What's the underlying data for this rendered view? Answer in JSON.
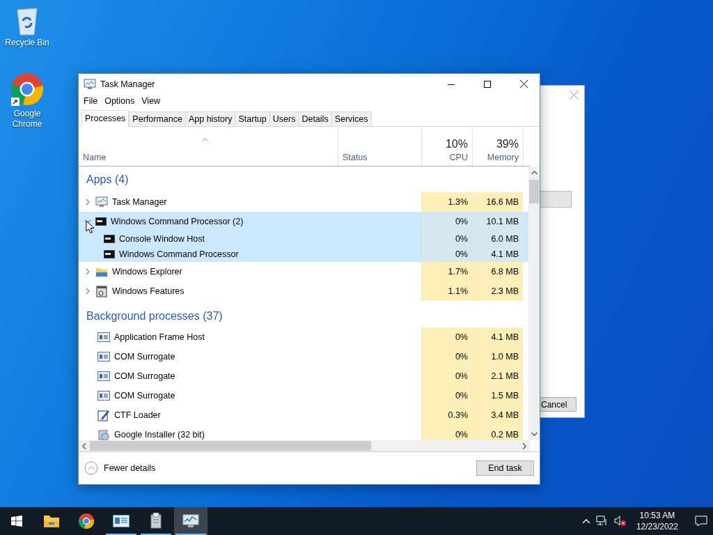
{
  "desktop_icons": [
    {
      "label": "Recycle Bin",
      "kind": "recycle"
    },
    {
      "label": "Google Chrome",
      "kind": "chrome"
    }
  ],
  "back_dialog": {
    "button": "Cancel"
  },
  "window": {
    "title": "Task Manager"
  },
  "menu": [
    "File",
    "Options",
    "View"
  ],
  "tabs": [
    {
      "label": "Processes",
      "selected": true
    },
    {
      "label": "Performance",
      "selected": false
    },
    {
      "label": "App history",
      "selected": false
    },
    {
      "label": "Startup",
      "selected": false
    },
    {
      "label": "Users",
      "selected": false
    },
    {
      "label": "Details",
      "selected": false
    },
    {
      "label": "Services",
      "selected": false
    }
  ],
  "columns": {
    "name": "Name",
    "status": "Status",
    "cpu": {
      "total": "10%",
      "label": "CPU"
    },
    "memory": {
      "total": "39%",
      "label": "Memory"
    }
  },
  "sections": [
    {
      "title": "Apps (4)",
      "rows": [
        {
          "name": "Task Manager",
          "kind": "taskmgr",
          "expanded": false,
          "selected": false,
          "cpu": "1.3%",
          "memory": "16.6 MB"
        },
        {
          "name": "Windows Command Processor (2)",
          "kind": "cmd",
          "expanded": true,
          "selected": true,
          "cpu": "0%",
          "memory": "10.1 MB",
          "children": [
            {
              "name": "Console Window Host",
              "kind": "cmd",
              "selected": true,
              "cpu": "0%",
              "memory": "6.0 MB"
            },
            {
              "name": "Windows Command Processor",
              "kind": "cmd",
              "selected": true,
              "cpu": "0%",
              "memory": "4.1 MB"
            }
          ]
        },
        {
          "name": "Windows Explorer",
          "kind": "explorer",
          "expanded": false,
          "selected": false,
          "cpu": "1.7%",
          "memory": "6.8 MB"
        },
        {
          "name": "Windows Features",
          "kind": "features",
          "expanded": false,
          "selected": false,
          "cpu": "1.1%",
          "memory": "2.3 MB"
        }
      ]
    },
    {
      "title": "Background processes (37)",
      "rows": [
        {
          "name": "Application Frame Host",
          "kind": "service",
          "selected": false,
          "cpu": "0%",
          "memory": "4.1 MB"
        },
        {
          "name": "COM Surrogate",
          "kind": "service",
          "selected": false,
          "cpu": "0%",
          "memory": "1.0 MB"
        },
        {
          "name": "COM Surrogate",
          "kind": "service",
          "selected": false,
          "cpu": "0%",
          "memory": "2.1 MB"
        },
        {
          "name": "COM Surrogate",
          "kind": "service",
          "selected": false,
          "cpu": "0%",
          "memory": "1.5 MB"
        },
        {
          "name": "CTF Loader",
          "kind": "ctf",
          "selected": false,
          "cpu": "0.3%",
          "memory": "3.4 MB"
        },
        {
          "name": "Google Installer (32 bit)",
          "kind": "installer",
          "selected": false,
          "cpu": "0%",
          "memory": "0.2 MB"
        }
      ]
    }
  ],
  "footer": {
    "toggle": "Fewer details",
    "button": "End task"
  },
  "taskbar": {
    "items": [
      {
        "kind": "start",
        "running": false,
        "active": false
      },
      {
        "kind": "explorer",
        "running": false,
        "active": false
      },
      {
        "kind": "chrome",
        "running": false,
        "active": false
      },
      {
        "kind": "card",
        "running": true,
        "active": false
      },
      {
        "kind": "installer",
        "running": true,
        "active": false
      },
      {
        "kind": "taskmgr",
        "running": true,
        "active": true
      }
    ],
    "clock": {
      "time": "10:53 AM",
      "date": "12/23/2022"
    }
  }
}
